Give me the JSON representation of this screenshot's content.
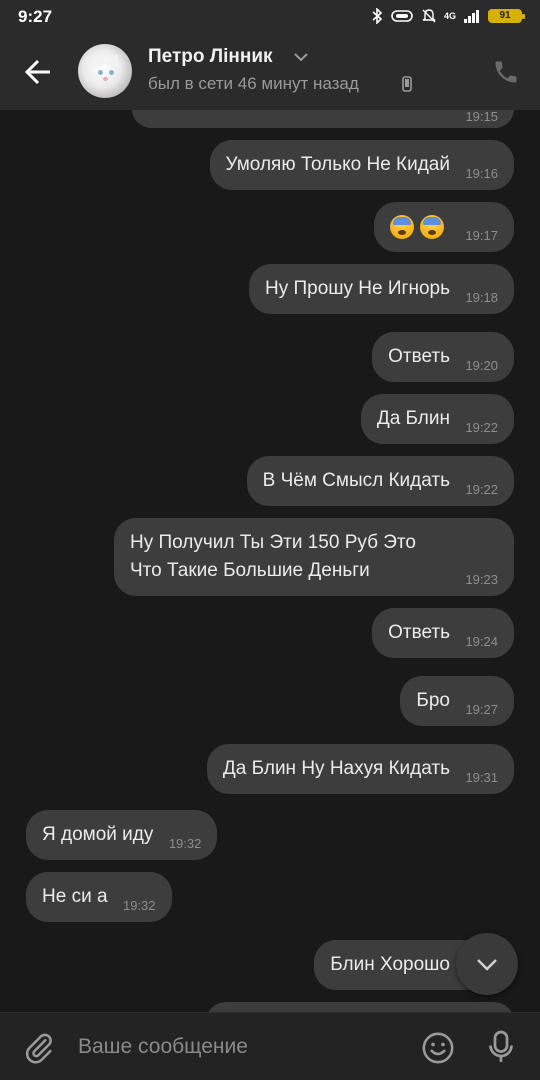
{
  "status_bar": {
    "time": "9:27",
    "network": "4G",
    "battery": "91",
    "battery_color": "#d6b100"
  },
  "header": {
    "contact_name": "Петро Лінник",
    "last_seen": "был в сети 46 минут назад",
    "icons": {
      "back": "arrow-left-icon",
      "call": "phone-icon",
      "device": "smartphone-icon",
      "expand": "chevron-down-icon"
    }
  },
  "messages": [
    {
      "text": "",
      "time": "19:15",
      "side": "out"
    },
    {
      "text": "Умоляю Только Не Кидай",
      "time": "19:16",
      "side": "out"
    },
    {
      "text": "",
      "emoji": [
        "anxious-face-with-sweat",
        "anxious-face-with-sweat"
      ],
      "time": "19:17",
      "side": "out"
    },
    {
      "text": "Ну Прошу Не Игнорь",
      "time": "19:18",
      "side": "out"
    },
    {
      "text": "Ответь",
      "time": "19:20",
      "side": "out"
    },
    {
      "text": "Да Блин",
      "time": "19:22",
      "side": "out"
    },
    {
      "text": "В Чём Смысл Кидать",
      "time": "19:22",
      "side": "out"
    },
    {
      "text": "Ну Получил Ты Эти 150 Руб Это Что Такие Большие Деньги",
      "time": "19:23",
      "side": "out"
    },
    {
      "text": "Ответь",
      "time": "19:24",
      "side": "out"
    },
    {
      "text": "Бро",
      "time": "19:27",
      "side": "out"
    },
    {
      "text": "Да Блин Ну Нахуя Кидать",
      "time": "19:31",
      "side": "out"
    },
    {
      "text": "Я домой иду",
      "time": "19:32",
      "side": "in"
    },
    {
      "text": "Не си а",
      "time": "19:32",
      "side": "in"
    },
    {
      "text": "Блин Хорошо",
      "time": "",
      "side": "out"
    }
  ],
  "composer": {
    "placeholder": "Ваше сообщение",
    "icons": {
      "attach": "paperclip-icon",
      "emoji": "smile-icon",
      "voice": "microphone-icon"
    }
  },
  "colors": {
    "background": "#191919",
    "header": "#2b2b2b",
    "bubble": "#3d3d3d",
    "time_text": "#8d8d8d"
  }
}
